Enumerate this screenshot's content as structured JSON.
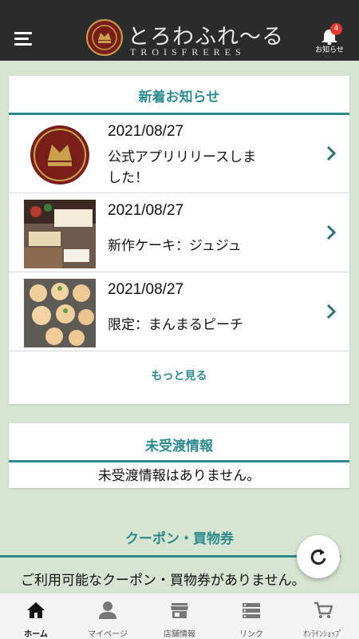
{
  "header": {
    "logo_title": "とろわふれ～る",
    "logo_sub": "TROISFRERES",
    "notification_count": "4",
    "notification_label": "お知らせ"
  },
  "news": {
    "title": "新着お知らせ",
    "items": [
      {
        "date": "2021/08/27",
        "title": "公式アプリリリースしました！"
      },
      {
        "date": "2021/08/27",
        "title": "新作ケーキ：ジュジュ"
      },
      {
        "date": "2021/08/27",
        "title": "限定：まんまるピーチ"
      }
    ],
    "more_label": "もっと見る"
  },
  "undelivered": {
    "title": "未受渡情報",
    "empty_text": "未受渡情報はありません。"
  },
  "coupons": {
    "title": "クーポン・買物券",
    "empty_text": "ご利用可能なクーポン・買物券がありません。"
  },
  "bottom_nav": {
    "items": [
      {
        "label": "ホーム",
        "icon": "home-icon",
        "active": true
      },
      {
        "label": "マイページ",
        "icon": "person-icon",
        "active": false
      },
      {
        "label": "店舗情報",
        "icon": "store-icon",
        "active": false
      },
      {
        "label": "リンク",
        "icon": "list-icon",
        "active": false
      },
      {
        "label": "ｵﾝﾗｲﾝｼｮｯﾌﾟ",
        "icon": "cart-icon",
        "active": false
      }
    ]
  },
  "colors": {
    "accent": "#2e8a8f",
    "background": "#d6e5d1",
    "header": "#2b2b2b",
    "badge": "#e53935"
  }
}
